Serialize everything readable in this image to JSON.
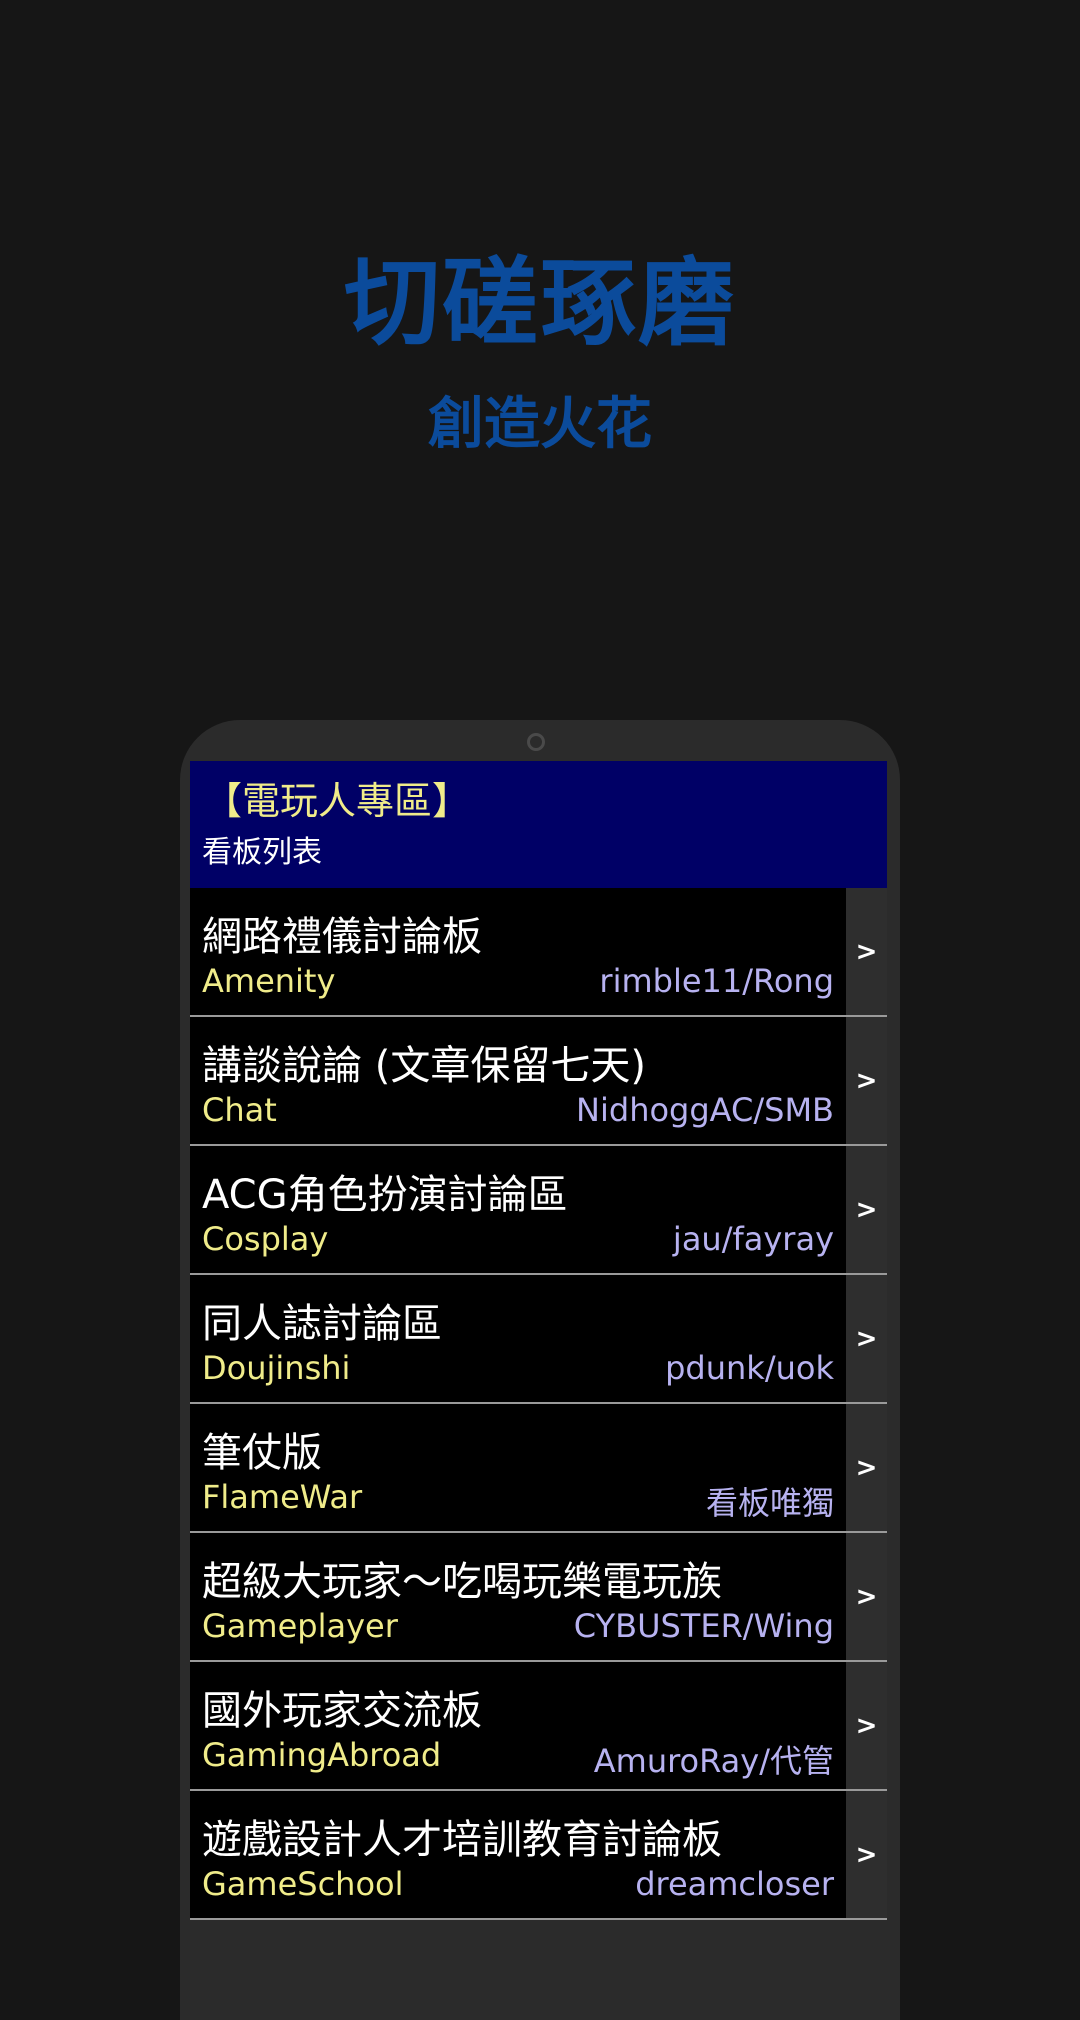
{
  "hero": {
    "title": "切磋琢磨",
    "subtitle": "創造火花"
  },
  "header": {
    "title": "【電玩人專區】",
    "subtitle": "看板列表"
  },
  "boards": [
    {
      "title": "網路禮儀討論板",
      "name": "Amenity",
      "mods": "rimble11/Rong",
      "arrow": ">"
    },
    {
      "title": "講談說論 (文章保留七天)",
      "name": "Chat",
      "mods": "NidhoggAC/SMB",
      "arrow": ">"
    },
    {
      "title": "ACG角色扮演討論區",
      "name": "Cosplay",
      "mods": "jau/fayray",
      "arrow": ">"
    },
    {
      "title": "同人誌討論區",
      "name": "Doujinshi",
      "mods": "pdunk/uok",
      "arrow": ">"
    },
    {
      "title": "筆仗版",
      "name": "FlameWar",
      "mods": "看板唯獨",
      "arrow": ">"
    },
    {
      "title": "超級大玩家～吃喝玩樂電玩族",
      "name": "Gameplayer",
      "mods": "CYBUSTER/Wing",
      "arrow": ">"
    },
    {
      "title": "國外玩家交流板",
      "name": "GamingAbroad",
      "mods": "AmuroRay/代管",
      "arrow": ">"
    },
    {
      "title": "遊戲設計人才培訓教育討論板",
      "name": "GameSchool",
      "mods": "dreamcloser",
      "arrow": ">"
    }
  ],
  "colors": {
    "hero": "#0b4b9b",
    "header_bg": "#000066",
    "board_name": "#f0ec8a",
    "moderators": "#b7b2f0"
  }
}
